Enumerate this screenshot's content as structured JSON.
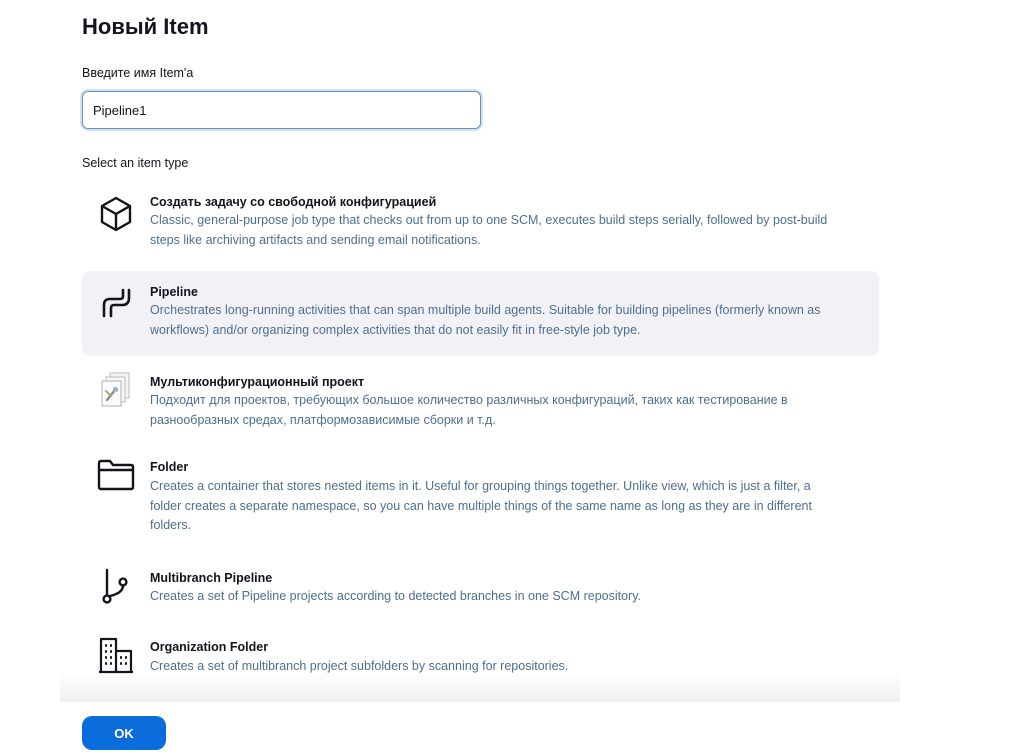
{
  "page": {
    "title": "Новый Item"
  },
  "name_field": {
    "label": "Введите имя Item'а",
    "value": "Pipeline1"
  },
  "item_type": {
    "label": "Select an item type",
    "items": [
      {
        "icon": "freestyle-cube-icon",
        "title": "Создать задачу со свободной конфигурацией",
        "desc_lines": [
          "Classic, general-purpose job type that checks out from up to one SCM, executes build steps serially, followed by post-build",
          "steps like archiving artifacts and sending email notifications."
        ],
        "selected": false
      },
      {
        "icon": "pipeline-icon",
        "title": "Pipeline",
        "desc_lines": [
          "Orchestrates long-running activities that can span multiple build agents. Suitable for building pipelines (formerly known as",
          "workflows) and/or organizing complex activities that do not easily fit in free-style job type."
        ],
        "selected": true
      },
      {
        "icon": "multi-config-project-icon",
        "title": "Мультиконфигурационный проект",
        "desc_lines": [
          "Подходит для проектов, требующих большое количество различных конфигураций, таких как тестирование в",
          "разнообразных средах, платформозависимые сборки и т.д."
        ],
        "selected": false
      },
      {
        "icon": "folder-icon",
        "title": "Folder",
        "desc_lines": [
          "Creates a container that stores nested items in it. Useful for grouping things together. Unlike view, which is just a filter, a",
          "folder creates a separate namespace, so you can have multiple things of the same name as long as they are in different",
          "folders."
        ],
        "selected": false
      },
      {
        "icon": "branch-icon",
        "title": "Multibranch Pipeline",
        "desc_lines": [
          "Creates a set of Pipeline projects according to detected branches in one SCM repository."
        ],
        "selected": false
      },
      {
        "icon": "organization-building-icon",
        "title": "Organization Folder",
        "desc_lines": [
          "Creates a set of multibranch project subfolders by scanning for repositories."
        ],
        "selected": false
      }
    ]
  },
  "footer": {
    "ok_label": "OK"
  },
  "colors": {
    "accent": "#0b6ddc",
    "description_text": "#4e6f8f",
    "selected_bg": "#f2f2f6"
  }
}
